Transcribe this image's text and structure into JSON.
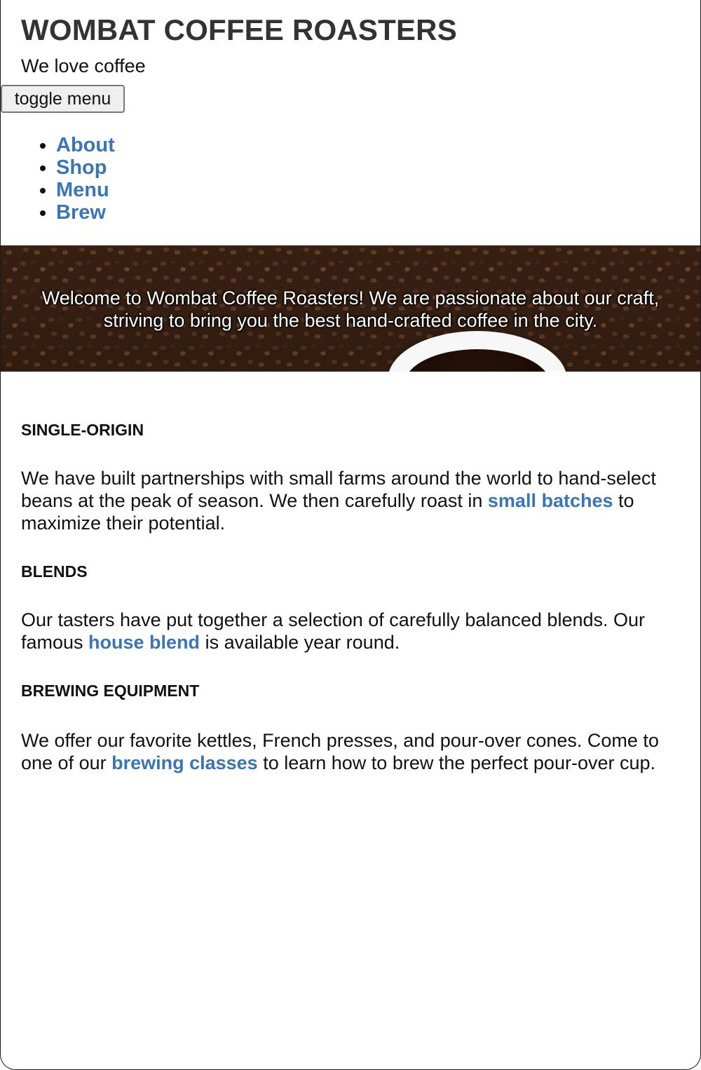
{
  "header": {
    "title": "WOMBAT COFFEE ROASTERS",
    "tagline": "We love coffee",
    "toggle_label": "toggle menu"
  },
  "nav": {
    "items": [
      {
        "label": "About"
      },
      {
        "label": "Shop"
      },
      {
        "label": "Menu"
      },
      {
        "label": "Brew"
      }
    ]
  },
  "hero": {
    "text": "Welcome to Wombat Coffee Roasters! We are passionate about our craft, striving to bring you the best hand-crafted coffee in the city.",
    "image_icon": "coffee-beans-and-cup-image"
  },
  "sections": [
    {
      "heading": "SINGLE-ORIGIN",
      "text_before": "We have built partnerships with small farms around the world to hand-select beans at the peak of season. We then carefully roast in ",
      "link": "small batches",
      "text_after": " to maximize their potential."
    },
    {
      "heading": "BLENDS",
      "text_before": "Our tasters have put together a selection of carefully balanced blends. Our famous ",
      "link": "house blend",
      "text_after": " is available year round."
    },
    {
      "heading": "BREWING EQUIPMENT",
      "text_before": "We offer our favorite kettles, French presses, and pour-over cones. Come to one of our ",
      "link": "brewing classes",
      "text_after": " to learn how to brew the perfect pour-over cup."
    }
  ],
  "colors": {
    "link": "#3a75b5",
    "title": "#333333",
    "text": "#111111"
  }
}
